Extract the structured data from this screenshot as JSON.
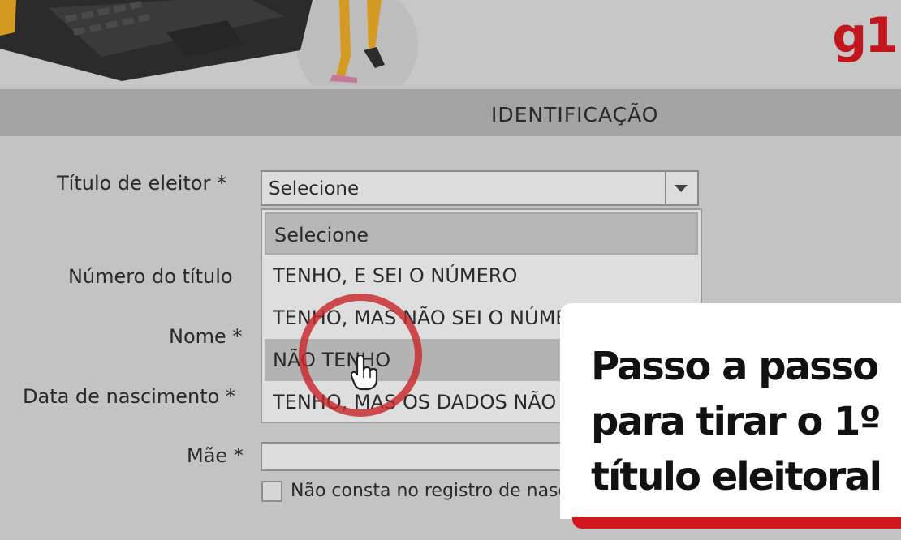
{
  "brand": {
    "logo": "g1",
    "accent_color": "#d3161d"
  },
  "section": {
    "title": "IDENTIFICAÇÃO"
  },
  "form": {
    "titulo_label": "Título de eleitor *",
    "titulo_select": {
      "value": "Selecione",
      "options": [
        "Selecione",
        "TENHO, E SEI O NÚMERO",
        "TENHO, MAS NÃO SEI O NÚMERO",
        "NÃO TENHO",
        "TENHO, MAS OS DADOS NÃO CONFEREM"
      ],
      "highlighted_option": "NÃO TENHO"
    },
    "numero_label": "Número do título",
    "nome_label": "Nome *",
    "nascimento_label": "Data de nascimento *",
    "mae_label": "Mãe *",
    "mae_checkbox_label": "Não consta no registro de nascimento"
  },
  "promo": {
    "line1": "Passo a passo",
    "line2": "para tirar o 1º",
    "line3": "título eleitoral"
  },
  "icons": [
    "laptop-illustration",
    "person-legs-illustration",
    "chevron-down-icon",
    "hand-cursor-icon",
    "highlight-circle"
  ]
}
